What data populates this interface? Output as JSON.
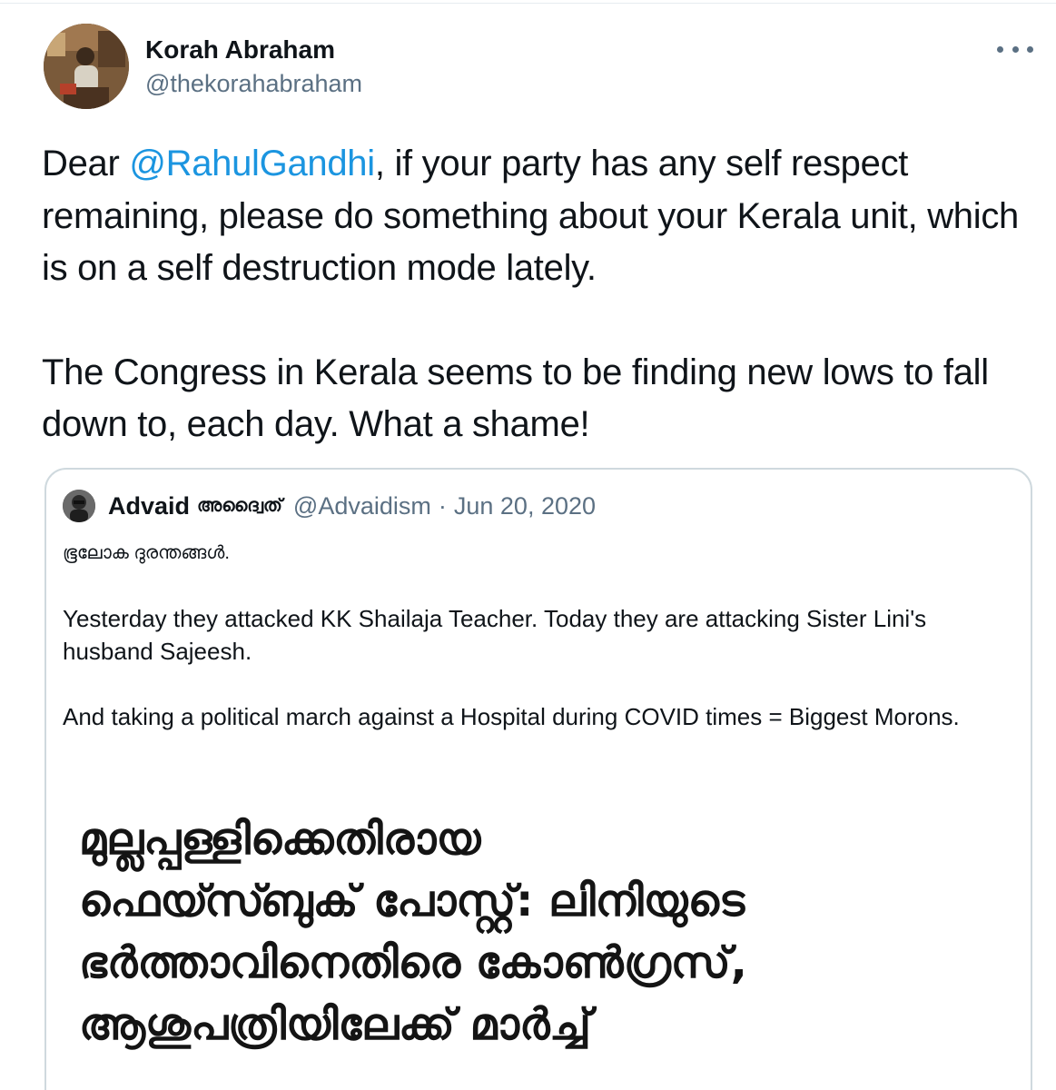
{
  "tweet": {
    "author": {
      "name": "Korah Abraham",
      "handle": "@thekorahabraham"
    },
    "text": {
      "p1_before": "Dear ",
      "mention": "@RahulGandhi",
      "p1_after": ", if your party has any self respect remaining, please do something about your Kerala unit, which is on a self destruction mode lately.",
      "p2": "The Congress in Kerala seems to be finding new lows to fall down to, each day. What a shame!"
    }
  },
  "quoted": {
    "author": {
      "name": "Advaid",
      "name_ml": "അദ്വൈത്",
      "handle": "@Advaidism"
    },
    "separator": "·",
    "date": "Jun 20, 2020",
    "body": {
      "line1": "ഭൂലോക ദുരന്തങ്ങൾ.",
      "para2": "Yesterday they attacked KK Shailaja Teacher. Today they are attacking Sister Lini's husband Sajeesh.",
      "para3": "And taking a political march against a Hospital during COVID times = Biggest Morons."
    },
    "image_headline": [
      "മുല്ലപ്പള്ളിക്കെതിരായ",
      "ഫെയ്സ്ബുക് പോസ്റ്റ്: ലിനിയുടെ",
      "ഭർത്താവിനെതിരെ കോൺഗ്രസ്,",
      "ആശുപത്രിയിലേക്ക് മാർച്ച്"
    ]
  },
  "colors": {
    "mention": "#1b95e0",
    "secondary_text": "#5b7083",
    "border": "#cfd9de"
  },
  "icons": {
    "more": "more-dots-icon"
  }
}
